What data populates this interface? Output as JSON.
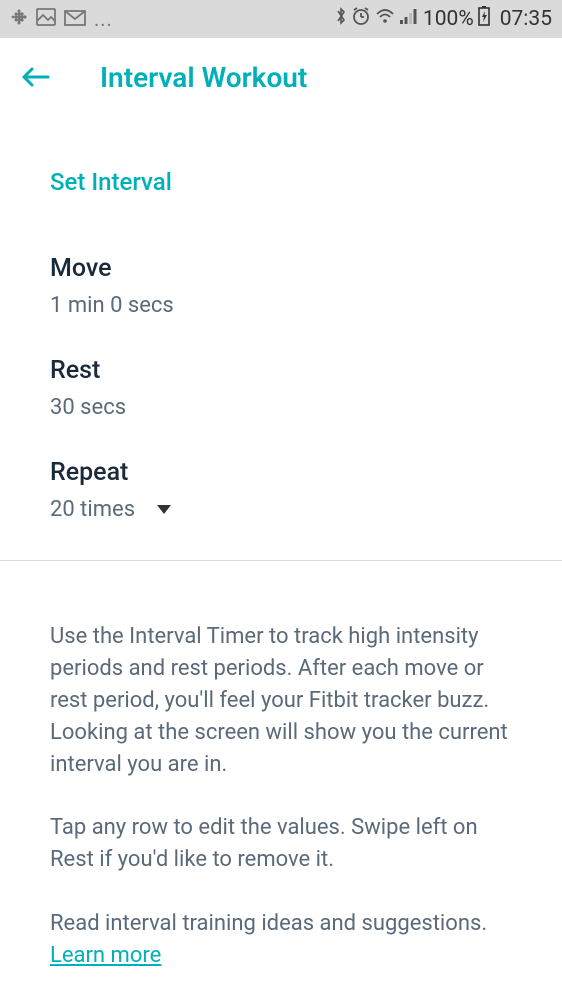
{
  "statusbar": {
    "battery_pct": "100%",
    "time": "07:35"
  },
  "header": {
    "title": "Interval Workout"
  },
  "section_title": "Set Interval",
  "rows": {
    "move": {
      "label": "Move",
      "value": "1 min 0 secs"
    },
    "rest": {
      "label": "Rest",
      "value": "30 secs"
    },
    "repeat": {
      "label": "Repeat",
      "value": "20 times"
    }
  },
  "info": {
    "p1": "Use the Interval Timer to track high intensity periods and rest periods. After each move or rest period, you'll feel your Fitbit tracker buzz. Looking at the screen will show you the current interval you are in.",
    "p2": "Tap any row to edit the values. Swipe left on Rest if you'd like to remove it.",
    "p3": "Read interval training ideas and suggestions.",
    "learn_more": "Learn more"
  }
}
